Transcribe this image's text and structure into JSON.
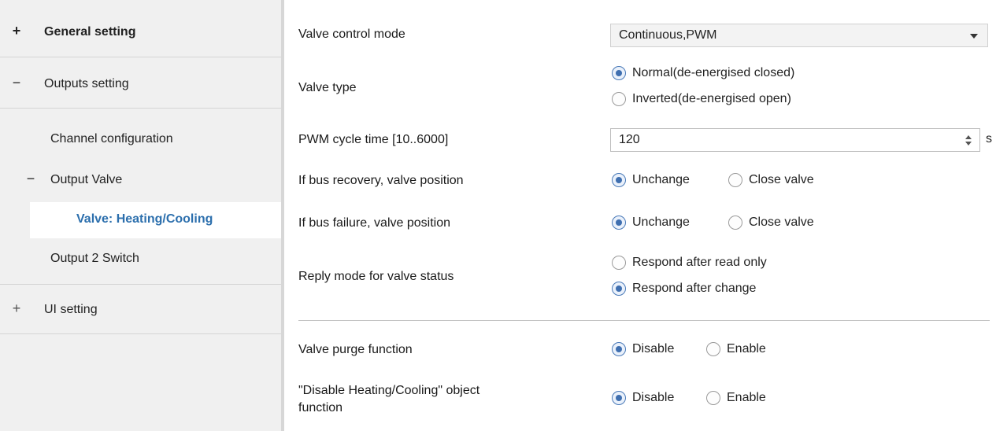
{
  "sidebar": {
    "items": [
      {
        "sign": "+",
        "label": "General setting"
      },
      {
        "sign": "−",
        "label": "Outputs setting"
      },
      {
        "sign": "",
        "label": "Channel configuration"
      },
      {
        "sign": "−",
        "label": "Output Valve"
      },
      {
        "sign": "",
        "label": "Valve: Heating/Cooling"
      },
      {
        "sign": "",
        "label": "Output 2 Switch"
      },
      {
        "sign": "+",
        "label": "UI setting"
      }
    ]
  },
  "main": {
    "valve_control_mode": {
      "label": "Valve control mode",
      "value": "Continuous,PWM"
    },
    "valve_type": {
      "label": "Valve type",
      "options": [
        "Normal(de-energised closed)",
        "Inverted(de-energised open)"
      ],
      "selected": 0
    },
    "pwm_cycle": {
      "label": "PWM cycle time [10..6000]",
      "value": "120",
      "unit": "s"
    },
    "bus_recovery": {
      "label": "If bus recovery, valve position",
      "options": [
        "Unchange",
        "Close valve"
      ],
      "selected": 0
    },
    "bus_failure": {
      "label": "If bus failure, valve position",
      "options": [
        "Unchange",
        "Close valve"
      ],
      "selected": 0
    },
    "reply_mode": {
      "label": "Reply mode for valve status",
      "options": [
        "Respond after read only",
        "Respond after change"
      ],
      "selected": 1
    },
    "purge": {
      "label": "Valve purge function",
      "options": [
        "Disable",
        "Enable"
      ],
      "selected": 0
    },
    "disable_hc": {
      "label_line1": "\"Disable Heating/Cooling\" object",
      "label_line2": "function",
      "options": [
        "Disable",
        "Enable"
      ],
      "selected": 0
    }
  }
}
